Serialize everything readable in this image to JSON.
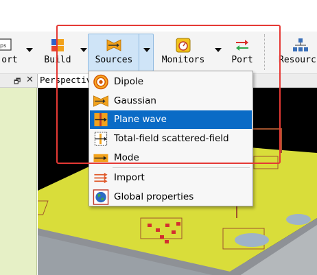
{
  "toolbar": {
    "items": [
      {
        "label": "ort",
        "icon": "port-icon"
      },
      {
        "label": "Build",
        "icon": "build-icon"
      },
      {
        "label": "Sources",
        "icon": "sources-icon",
        "active": true
      },
      {
        "label": "Monitors",
        "icon": "monitors-icon"
      },
      {
        "label": "Port",
        "icon": "port-arrows-icon"
      },
      {
        "label": "Resourc",
        "icon": "resources-icon"
      }
    ]
  },
  "tabs": {
    "perspective_label": "Perspectiv"
  },
  "sources_menu": {
    "items": [
      {
        "label": "Dipole",
        "icon": "dipole-icon"
      },
      {
        "label": "Gaussian",
        "icon": "gaussian-icon"
      },
      {
        "label": "Plane wave",
        "icon": "plane-wave-icon",
        "highlighted": true
      },
      {
        "label": "Total-field scattered-field",
        "icon": "tfsf-icon"
      },
      {
        "label": "Mode",
        "icon": "mode-icon"
      },
      {
        "label": "Import",
        "icon": "import-icon"
      },
      {
        "label": "Global properties",
        "icon": "global-properties-icon"
      }
    ]
  },
  "colors": {
    "highlight": "#0a6bc6",
    "annotation": "#e53935",
    "substrate": "#d9dd3a",
    "viewport_bg": "#000000"
  }
}
